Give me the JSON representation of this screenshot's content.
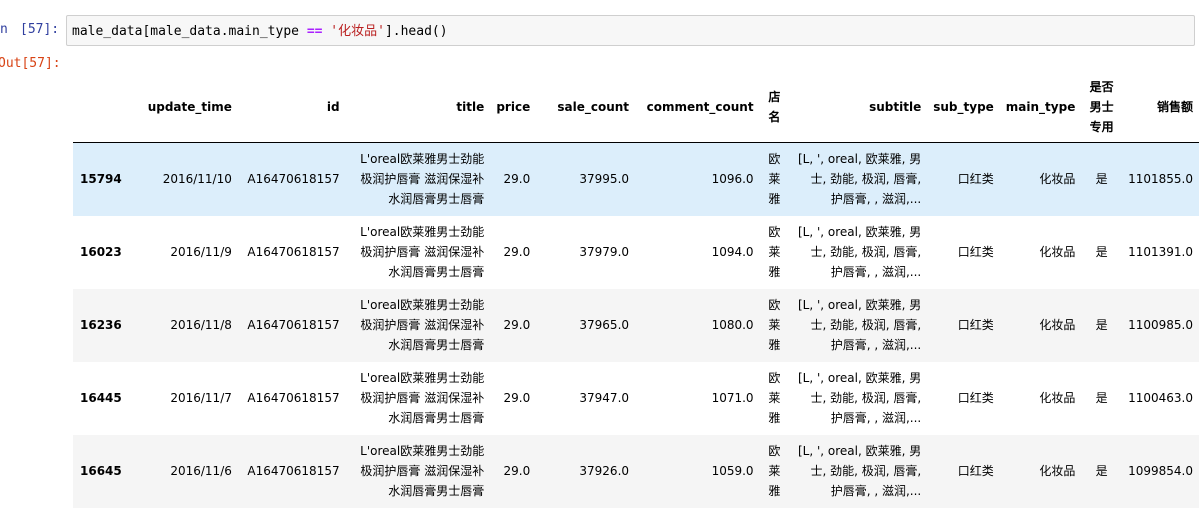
{
  "input_prompt": {
    "head": "n",
    "label": "[57]:"
  },
  "output_prompt": "Out[57]:",
  "code": {
    "part1": "male_data[male_data.main_type ",
    "op": "==",
    "space": " ",
    "string": "'化妆品'",
    "part2": "].head()"
  },
  "table": {
    "columns": {
      "update_time": "update_time",
      "id": "id",
      "title": "title",
      "price": "price",
      "sale_count": "sale_count",
      "comment_count": "comment_count",
      "shop": "店名",
      "subtitle": "subtitle",
      "sub_type": "sub_type",
      "main_type": "main_type",
      "male_only": "是否男士专用",
      "sales_amount": "销售额"
    },
    "rows": [
      {
        "index": "15794",
        "update_time": "2016/11/10",
        "id": "A16470618157",
        "title": "L'oreal欧莱雅男士劲能极润护唇膏 滋润保湿补水润唇膏男士唇膏",
        "price": "29.0",
        "sale_count": "37995.0",
        "comment_count": "1096.0",
        "shop": "欧莱雅",
        "subtitle": "[L, ', oreal, 欧莱雅, 男士, 劲能, 极润, 唇膏, 护唇膏, , 滋润,...",
        "sub_type": "口红类",
        "main_type": "化妆品",
        "male_only": "是",
        "sales_amount": "1101855.0"
      },
      {
        "index": "16023",
        "update_time": "2016/11/9",
        "id": "A16470618157",
        "title": "L'oreal欧莱雅男士劲能极润护唇膏 滋润保湿补水润唇膏男士唇膏",
        "price": "29.0",
        "sale_count": "37979.0",
        "comment_count": "1094.0",
        "shop": "欧莱雅",
        "subtitle": "[L, ', oreal, 欧莱雅, 男士, 劲能, 极润, 唇膏, 护唇膏, , 滋润,...",
        "sub_type": "口红类",
        "main_type": "化妆品",
        "male_only": "是",
        "sales_amount": "1101391.0"
      },
      {
        "index": "16236",
        "update_time": "2016/11/8",
        "id": "A16470618157",
        "title": "L'oreal欧莱雅男士劲能极润护唇膏 滋润保湿补水润唇膏男士唇膏",
        "price": "29.0",
        "sale_count": "37965.0",
        "comment_count": "1080.0",
        "shop": "欧莱雅",
        "subtitle": "[L, ', oreal, 欧莱雅, 男士, 劲能, 极润, 唇膏, 护唇膏, , 滋润,...",
        "sub_type": "口红类",
        "main_type": "化妆品",
        "male_only": "是",
        "sales_amount": "1100985.0"
      },
      {
        "index": "16445",
        "update_time": "2016/11/7",
        "id": "A16470618157",
        "title": "L'oreal欧莱雅男士劲能极润护唇膏 滋润保湿补水润唇膏男士唇膏",
        "price": "29.0",
        "sale_count": "37947.0",
        "comment_count": "1071.0",
        "shop": "欧莱雅",
        "subtitle": "[L, ', oreal, 欧莱雅, 男士, 劲能, 极润, 唇膏, 护唇膏, , 滋润,...",
        "sub_type": "口红类",
        "main_type": "化妆品",
        "male_only": "是",
        "sales_amount": "1100463.0"
      },
      {
        "index": "16645",
        "update_time": "2016/11/6",
        "id": "A16470618157",
        "title": "L'oreal欧莱雅男士劲能极润护唇膏 滋润保湿补水润唇膏男士唇膏",
        "price": "29.0",
        "sale_count": "37926.0",
        "comment_count": "1059.0",
        "shop": "欧莱雅",
        "subtitle": "[L, ', oreal, 欧莱雅, 男士, 劲能, 极润, 唇膏, 护唇膏, , 滋润,...",
        "sub_type": "口红类",
        "main_type": "化妆品",
        "male_only": "是",
        "sales_amount": "1099854.0"
      }
    ]
  },
  "colors": {
    "highlight_row": "#dceefb",
    "striped_row": "#f5f5f5",
    "input_prompt": "#303f9f",
    "output_prompt": "#d84315",
    "code_keyword": "#aa22ff",
    "code_string": "#ba2121"
  }
}
